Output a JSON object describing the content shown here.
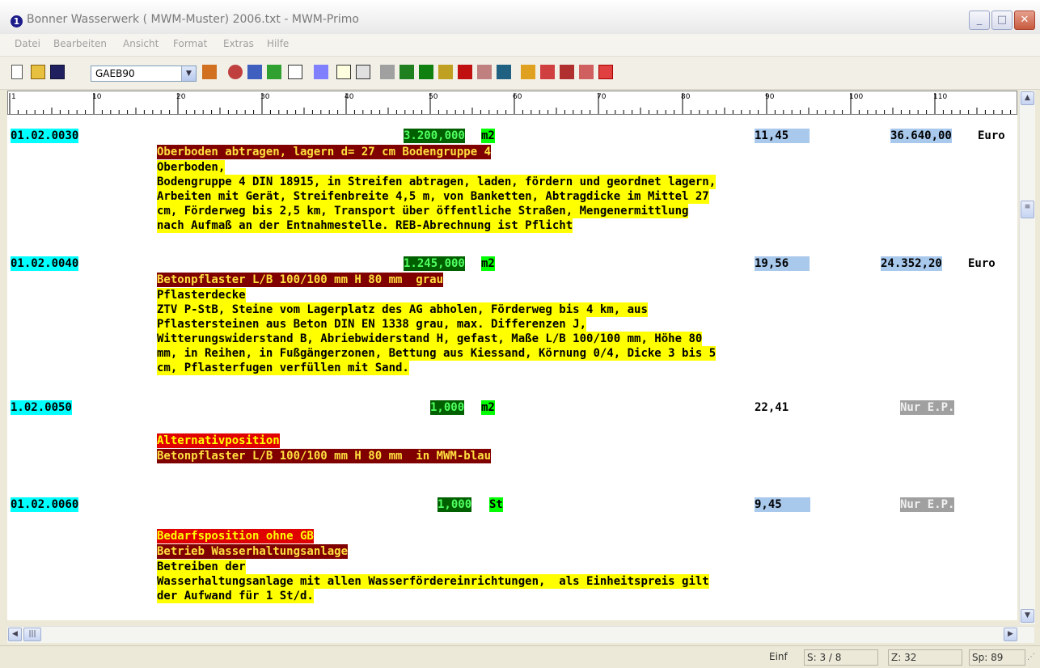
{
  "window": {
    "title": "Bonner Wasserwerk ( MWM-Muster) 2006.txt - MWM-Primo",
    "app_icon": "1",
    "minimize": "_",
    "maximize": "□",
    "close": "✕"
  },
  "menu": [
    "Datei",
    "Bearbeiten",
    "Ansicht",
    "Format",
    "Extras",
    "Hilfe"
  ],
  "toolbar": {
    "format_select": "GAEB90"
  },
  "ruler": {
    "labels": [
      "1",
      "10",
      "20",
      "30",
      "40",
      "50",
      "60",
      "70",
      "80",
      "90",
      "100",
      "110"
    ]
  },
  "positions": [
    {
      "nr": "01.02.0030",
      "qty": "3.200,000",
      "unit": "m2",
      "ep": "11,45",
      "gp": "36.640,00",
      "currency": "Euro",
      "short": "Oberboden abtragen, lagern d= 27 cm Bodengruppe 4",
      "long": [
        "Oberboden,",
        "Bodengruppe 4 DIN 18915, in Streifen abtragen, laden, fördern und geordnet lagern,",
        "Arbeiten mit Gerät, Streifenbreite 4,5 m, von Banketten, Abtragdicke im Mittel 27",
        "cm, Förderweg bis 2,5 km, Transport über öffentliche Straßen, Mengenermittlung",
        "nach Aufmaß an der Entnahmestelle. REB-Abrechnung ist Pflicht"
      ]
    },
    {
      "nr": "01.02.0040",
      "qty": "1.245,000",
      "unit": "m2",
      "ep": "19,56",
      "gp": "24.352,20",
      "currency": "Euro",
      "short": "Betonpflaster L/B 100/100 mm H 80 mm  grau",
      "long": [
        "Pflasterdecke",
        "ZTV P-StB, Steine vom Lagerplatz des AG abholen, Förderweg bis 4 km, aus",
        "Pflastersteinen aus Beton DIN EN 1338 grau, max. Differenzen J,",
        "Witterungswiderstand B, Abriebwiderstand H, gefast, Maße L/B 100/100 mm, Höhe 80",
        "mm, in Reihen, in Fußgängerzonen, Bettung aus Kiessand, Körnung 0/4, Dicke 3 bis 5",
        "cm, Pflasterfugen verfüllen mit Sand."
      ]
    },
    {
      "nr": "1.02.0050",
      "qty": "1,000",
      "unit": "m2",
      "ep": "22,41",
      "gp_label": "Nur E.P.",
      "flag": "Alternativposition",
      "short": "Betonpflaster L/B 100/100 mm H 80 mm  in MWM-blau"
    },
    {
      "nr": "01.02.0060",
      "qty": "1,000",
      "unit": "St",
      "ep": "9,45",
      "gp_label": "Nur E.P.",
      "flag": "Bedarfsposition ohne GB",
      "short": "Betrieb Wasserhaltungsanlage",
      "long": [
        "Betreiben der",
        "Wasserhaltungsanlage mit allen Wasserfördereinrichtungen,  als Einheitspreis gilt",
        "der Aufwand für 1 St/d."
      ]
    }
  ],
  "status": {
    "mode": "Einf",
    "page": "S: 3 / 8",
    "line": "Z: 32",
    "col": "Sp: 89"
  }
}
